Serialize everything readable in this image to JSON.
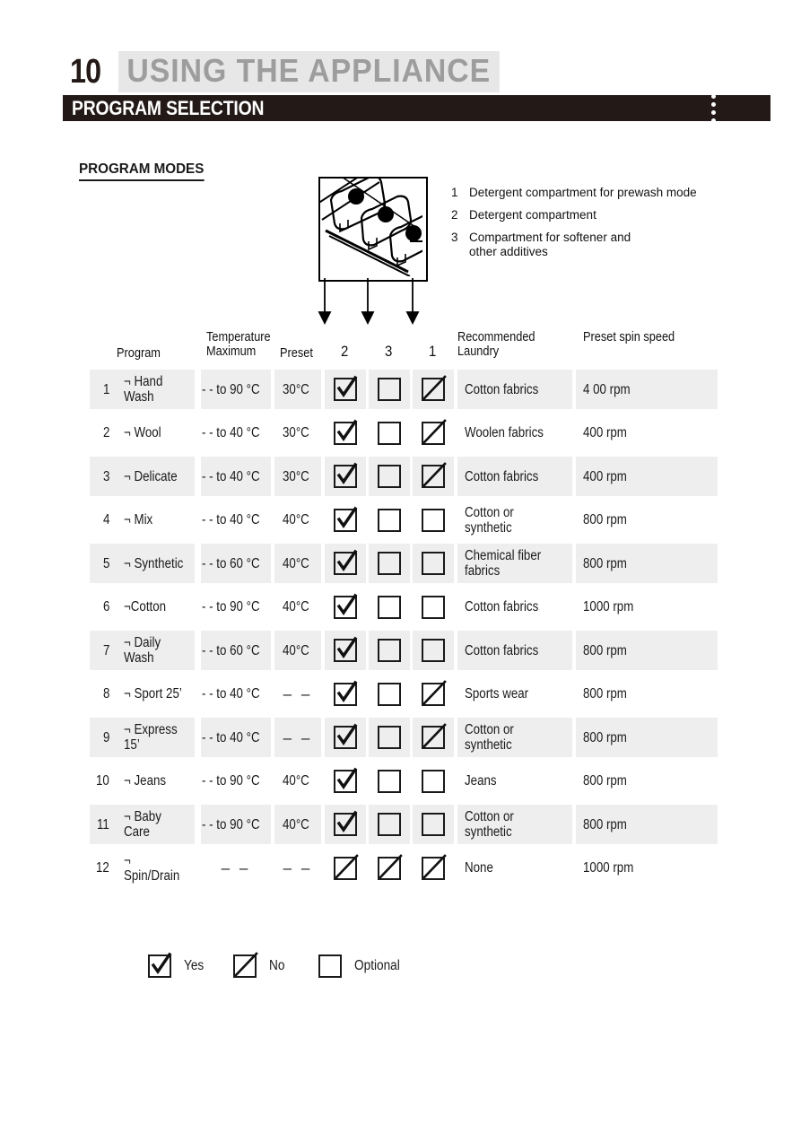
{
  "header": {
    "chapter_number": "10",
    "chapter_title": "USING THE  APPLIANCE",
    "section_title": "PROGRAM SELECTION",
    "bar_color": "#231a17",
    "chapter_title_color": "#9d9d9d",
    "chapter_title_bg": "#e7e7e7",
    "dot_count": 4
  },
  "subtitle": "PROGRAM MODES",
  "compartment_legend": [
    {
      "num": "1",
      "text": "Detergent compartment for prewash mode"
    },
    {
      "num": "2",
      "text": "Detergent compartment"
    },
    {
      "num": "3",
      "text": "Compartment for softener and\nother additives"
    }
  ],
  "arrow_targets": [
    "2",
    "3",
    "1"
  ],
  "table": {
    "headers": {
      "program": "Program",
      "temperature": "Temperature\nMaximum",
      "preset": "Preset",
      "col2": "2",
      "col3": "3",
      "col1": "1",
      "laundry": "Recommended\nLaundry",
      "spin": "Preset  spin speed"
    },
    "rows": [
      {
        "num": "1",
        "name": "¬ Hand Wash",
        "temp": "- - to 90 °C",
        "preset": "30°C",
        "b2": "yes",
        "b3": "optional",
        "b1": "no",
        "laundry": "Cotton fabrics",
        "spin": "4 00 rpm",
        "shaded": true
      },
      {
        "num": "2",
        "name": "¬ Wool",
        "temp": "- - to 40 °C",
        "preset": "30°C",
        "b2": "yes",
        "b3": "optional",
        "b1": "no",
        "laundry": "Woolen fabrics",
        "spin": "400 rpm",
        "shaded": false
      },
      {
        "num": "3",
        "name": "¬ Delicate",
        "temp": "- - to 40 °C",
        "preset": "30°C",
        "b2": "yes",
        "b3": "optional",
        "b1": "no",
        "laundry": "Cotton fabrics",
        "spin": "400 rpm",
        "shaded": true
      },
      {
        "num": "4",
        "name": "¬ Mix",
        "temp": "- - to 40 °C",
        "preset": "40°C",
        "b2": "yes",
        "b3": "optional",
        "b1": "optional",
        "laundry": "Cotton or synthetic",
        "spin": "800 rpm",
        "shaded": false
      },
      {
        "num": "5",
        "name": "¬ Synthetic",
        "temp": "- - to 60 °C",
        "preset": "40°C",
        "b2": "yes",
        "b3": "optional",
        "b1": "optional",
        "laundry": "Chemical fiber\nfabrics",
        "spin": "800 rpm",
        "shaded": true
      },
      {
        "num": "6",
        "name": "¬Cotton",
        "temp": "- - to 90 °C",
        "preset": "40°C",
        "b2": "yes",
        "b3": "optional",
        "b1": "optional",
        "laundry": "Cotton fabrics",
        "spin": "1000 rpm",
        "shaded": false
      },
      {
        "num": "7",
        "name": "¬ Daily Wash",
        "temp": "- - to 60 °C",
        "preset": "40°C",
        "b2": "yes",
        "b3": "optional",
        "b1": "optional",
        "laundry": "Cotton fabrics",
        "spin": "800 rpm",
        "shaded": true
      },
      {
        "num": "8",
        "name": "¬ Sport 25’",
        "temp": "- - to 40 °C",
        "preset": "– –",
        "b2": "yes",
        "b3": "optional",
        "b1": "no",
        "laundry": "Sports wear",
        "spin": "800 rpm",
        "shaded": false
      },
      {
        "num": "9",
        "name": "¬ Express 15’",
        "temp": "- - to 40 °C",
        "preset": "– –",
        "b2": "yes",
        "b3": "optional",
        "b1": "no",
        "laundry": "Cotton or synthetic",
        "spin": "800 rpm",
        "shaded": true
      },
      {
        "num": "10",
        "name": "¬ Jeans",
        "temp": "- - to 90 °C",
        "preset": "40°C",
        "b2": "yes",
        "b3": "optional",
        "b1": "optional",
        "laundry": "Jeans",
        "spin": "800 rpm",
        "shaded": false
      },
      {
        "num": "11",
        "name": "¬ Baby Care",
        "temp": "- - to 90 °C",
        "preset": "40°C",
        "b2": "yes",
        "b3": "optional",
        "b1": "optional",
        "laundry": "Cotton or synthetic",
        "spin": "800 rpm",
        "shaded": true
      },
      {
        "num": "12",
        "name": "¬ Spin/Drain",
        "temp": "– –",
        "preset": "– –",
        "b2": "no",
        "b3": "no",
        "b1": "no",
        "laundry": "None",
        "spin": "1000 rpm",
        "shaded": false
      }
    ]
  },
  "symbol_legend": [
    {
      "symbol": "yes",
      "label": "Yes"
    },
    {
      "symbol": "no",
      "label": "No"
    },
    {
      "symbol": "optional",
      "label": "Optional"
    }
  ]
}
